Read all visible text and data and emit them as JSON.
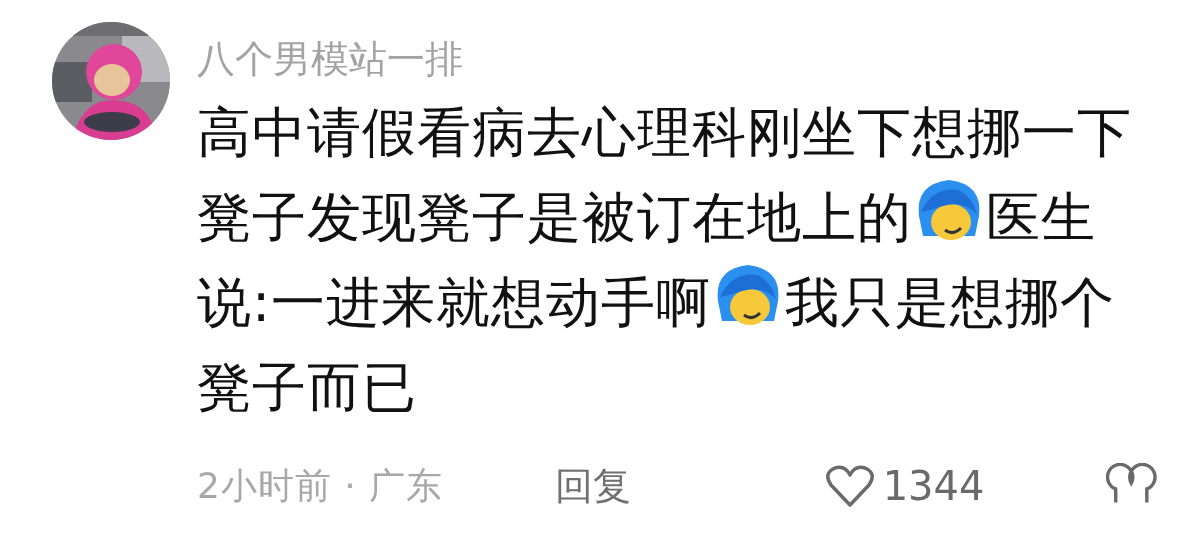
{
  "user": {
    "name": "八个男模站一排"
  },
  "comment": {
    "parts": [
      {
        "kind": "text",
        "text": "高中请假看病去心理科刚坐下想挪一下凳子发现凳子是被订在地上的"
      },
      {
        "kind": "emoji"
      },
      {
        "kind": "text",
        "text": "医生说:一进来就想动手啊"
      },
      {
        "kind": "emoji"
      },
      {
        "kind": "text",
        "text": "我只是想挪个凳子而已"
      }
    ]
  },
  "meta": "2小时前 · 广东",
  "actions": {
    "reply": "回复",
    "likes": "1344"
  }
}
